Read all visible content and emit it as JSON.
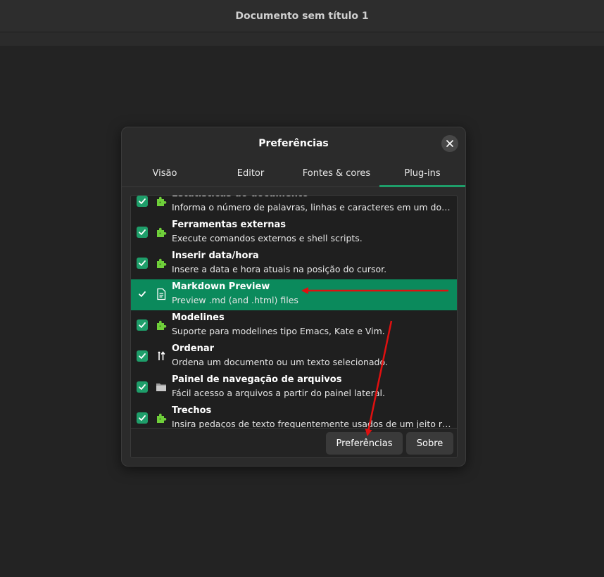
{
  "window": {
    "title": "Documento sem título 1"
  },
  "dialog": {
    "title": "Preferências",
    "tabs": [
      {
        "label": "Visão"
      },
      {
        "label": "Editor"
      },
      {
        "label": "Fontes & cores"
      },
      {
        "label": "Plug-ins"
      }
    ],
    "active_tab": "Plug-ins",
    "plugins": [
      {
        "name": "Estatísticas do documento",
        "description": "Informa o número de palavras, linhas e caracteres em um documento.",
        "enabled": true,
        "icon": "puzzle-icon"
      },
      {
        "name": "Ferramentas externas",
        "description": "Execute comandos externos e shell scripts.",
        "enabled": true,
        "icon": "puzzle-icon"
      },
      {
        "name": "Inserir data/hora",
        "description": "Insere a data e hora atuais na posição do cursor.",
        "enabled": true,
        "icon": "puzzle-icon"
      },
      {
        "name": "Markdown Preview",
        "description": "Preview .md (and .html) files",
        "enabled": true,
        "selected": true,
        "icon": "document-icon"
      },
      {
        "name": "Modelines",
        "description": "Suporte para modelines tipo Emacs, Kate e Vim.",
        "enabled": true,
        "icon": "puzzle-icon"
      },
      {
        "name": "Ordenar",
        "description": "Ordena um documento ou um texto selecionado.",
        "enabled": true,
        "icon": "sort-icon"
      },
      {
        "name": "Painel de navegação de arquivos",
        "description": "Fácil acesso a arquivos a partir do painel lateral.",
        "enabled": true,
        "icon": "folder-icon"
      },
      {
        "name": "Trechos",
        "description": "Insira pedaços de texto frequentemente usados de um jeito rápido.",
        "enabled": true,
        "icon": "puzzle-icon"
      }
    ],
    "buttons": {
      "preferences": "Preferências",
      "about": "Sobre"
    }
  },
  "colors": {
    "accent": "#1e9e6a",
    "selected_row": "#0b8a5c",
    "annotation_arrow": "#e01010"
  }
}
